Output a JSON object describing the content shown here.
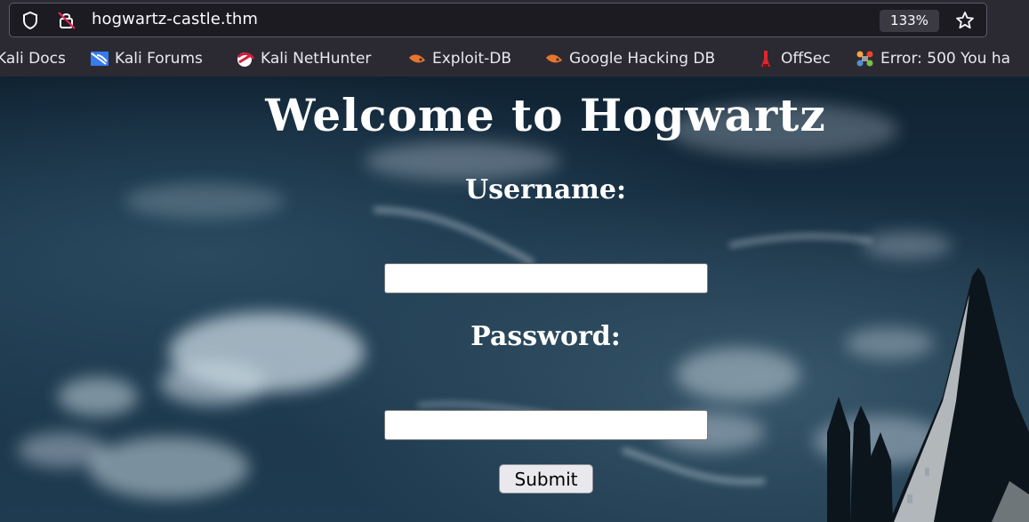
{
  "browser": {
    "url": "hogwartz-castle.thm",
    "zoom": "133%",
    "icons": {
      "shield": "tracking-protection-icon",
      "lock": "insecure-lock-icon",
      "star": "bookmark-star-icon"
    }
  },
  "bookmarks": [
    {
      "label": "Kali Docs",
      "icon": "kali-docs-icon"
    },
    {
      "label": "Kali Forums",
      "icon": "kali-forums-icon"
    },
    {
      "label": "Kali NetHunter",
      "icon": "kali-nethunter-icon"
    },
    {
      "label": "Exploit-DB",
      "icon": "exploit-db-icon"
    },
    {
      "label": "Google Hacking DB",
      "icon": "google-hacking-db-icon"
    },
    {
      "label": "OffSec",
      "icon": "offsec-icon"
    },
    {
      "label": "Error: 500 You ha",
      "icon": "joomla-icon"
    }
  ],
  "page": {
    "title": "Welcome to Hogwartz",
    "username_label": "Username:",
    "username_value": "",
    "password_label": "Password:",
    "password_value": "",
    "submit_label": "Submit"
  },
  "colors": {
    "chrome_bg": "#2b2a33",
    "urlbar_bg": "#1c1b22",
    "sky_dark": "#0f2232",
    "heading": "#ffffff"
  }
}
